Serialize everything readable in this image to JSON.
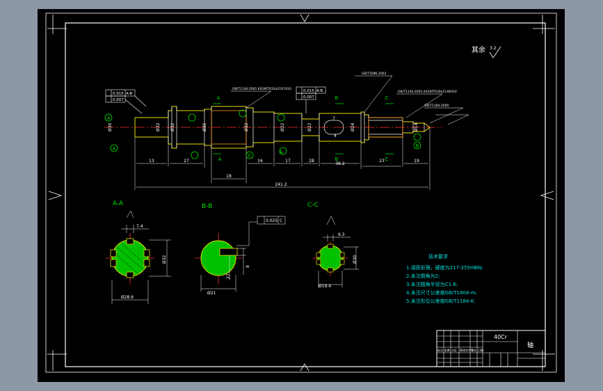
{
  "drawing": {
    "roughness_note": {
      "label": "其余",
      "value": "3.2"
    },
    "datum_labels": {
      "A": "A",
      "B": "B",
      "C": "C"
    },
    "tolerance_frames": {
      "left_top": [
        "0.015",
        "A-B"
      ],
      "left_bottom": [
        "0.007"
      ],
      "mid_top": [
        "0.015",
        "A-B"
      ],
      "mid_bottom": [
        "0.007"
      ]
    },
    "standards": {
      "a": "GB/T1144-2001 6X28f7X32a11X7d10",
      "b": "GB/T1096-2003",
      "c": "GB/T1144-2001 6X26f7X30a11X6d10",
      "d": "GB/T1184-2000"
    },
    "main_dimensions": {
      "d1": "13",
      "d2": "27",
      "d3": "18",
      "d4": "34",
      "d5": "17",
      "d6": "28",
      "d7": "36.2",
      "d8": "23",
      "d9": "19",
      "overall": "241.2",
      "n1": "Ø30",
      "n2": "Ø32",
      "n3": "Ø32",
      "n4": "Ø35",
      "n5": "Ø32",
      "n6": "Ø22",
      "n7": "Ø22",
      "n8": "Ø24",
      "n9": "Ø14",
      "key_width": "7",
      "key_depth": "4"
    },
    "sections": {
      "aa": {
        "title": "A-A",
        "dims": [
          "7.4",
          "Ø32",
          "Ø28.6"
        ]
      },
      "bb": {
        "title": "B-B",
        "tolerance": [
          "0.025",
          "C"
        ],
        "dims": [
          "8",
          "Ø21",
          "27"
        ]
      },
      "cc": {
        "title": "C-C",
        "dims": [
          "6.3",
          "Ø30",
          "Ø19.4"
        ]
      }
    },
    "tech_requirements": {
      "title": "技术要求",
      "lines": [
        "1.调质处理，硬度为217-255HBW;",
        "2.未注倒角为2;",
        "3.未注圆角半径为C1.6;",
        "4.未注尺寸公差按GB/T1804-m;",
        "5.未注形位公差按GB/T1184-K."
      ]
    },
    "title_block": {
      "material": "40Cr",
      "part_name": "轴",
      "headers": [
        "标记",
        "处数",
        "分区",
        "更改文件号",
        "签名",
        "日期"
      ]
    }
  }
}
